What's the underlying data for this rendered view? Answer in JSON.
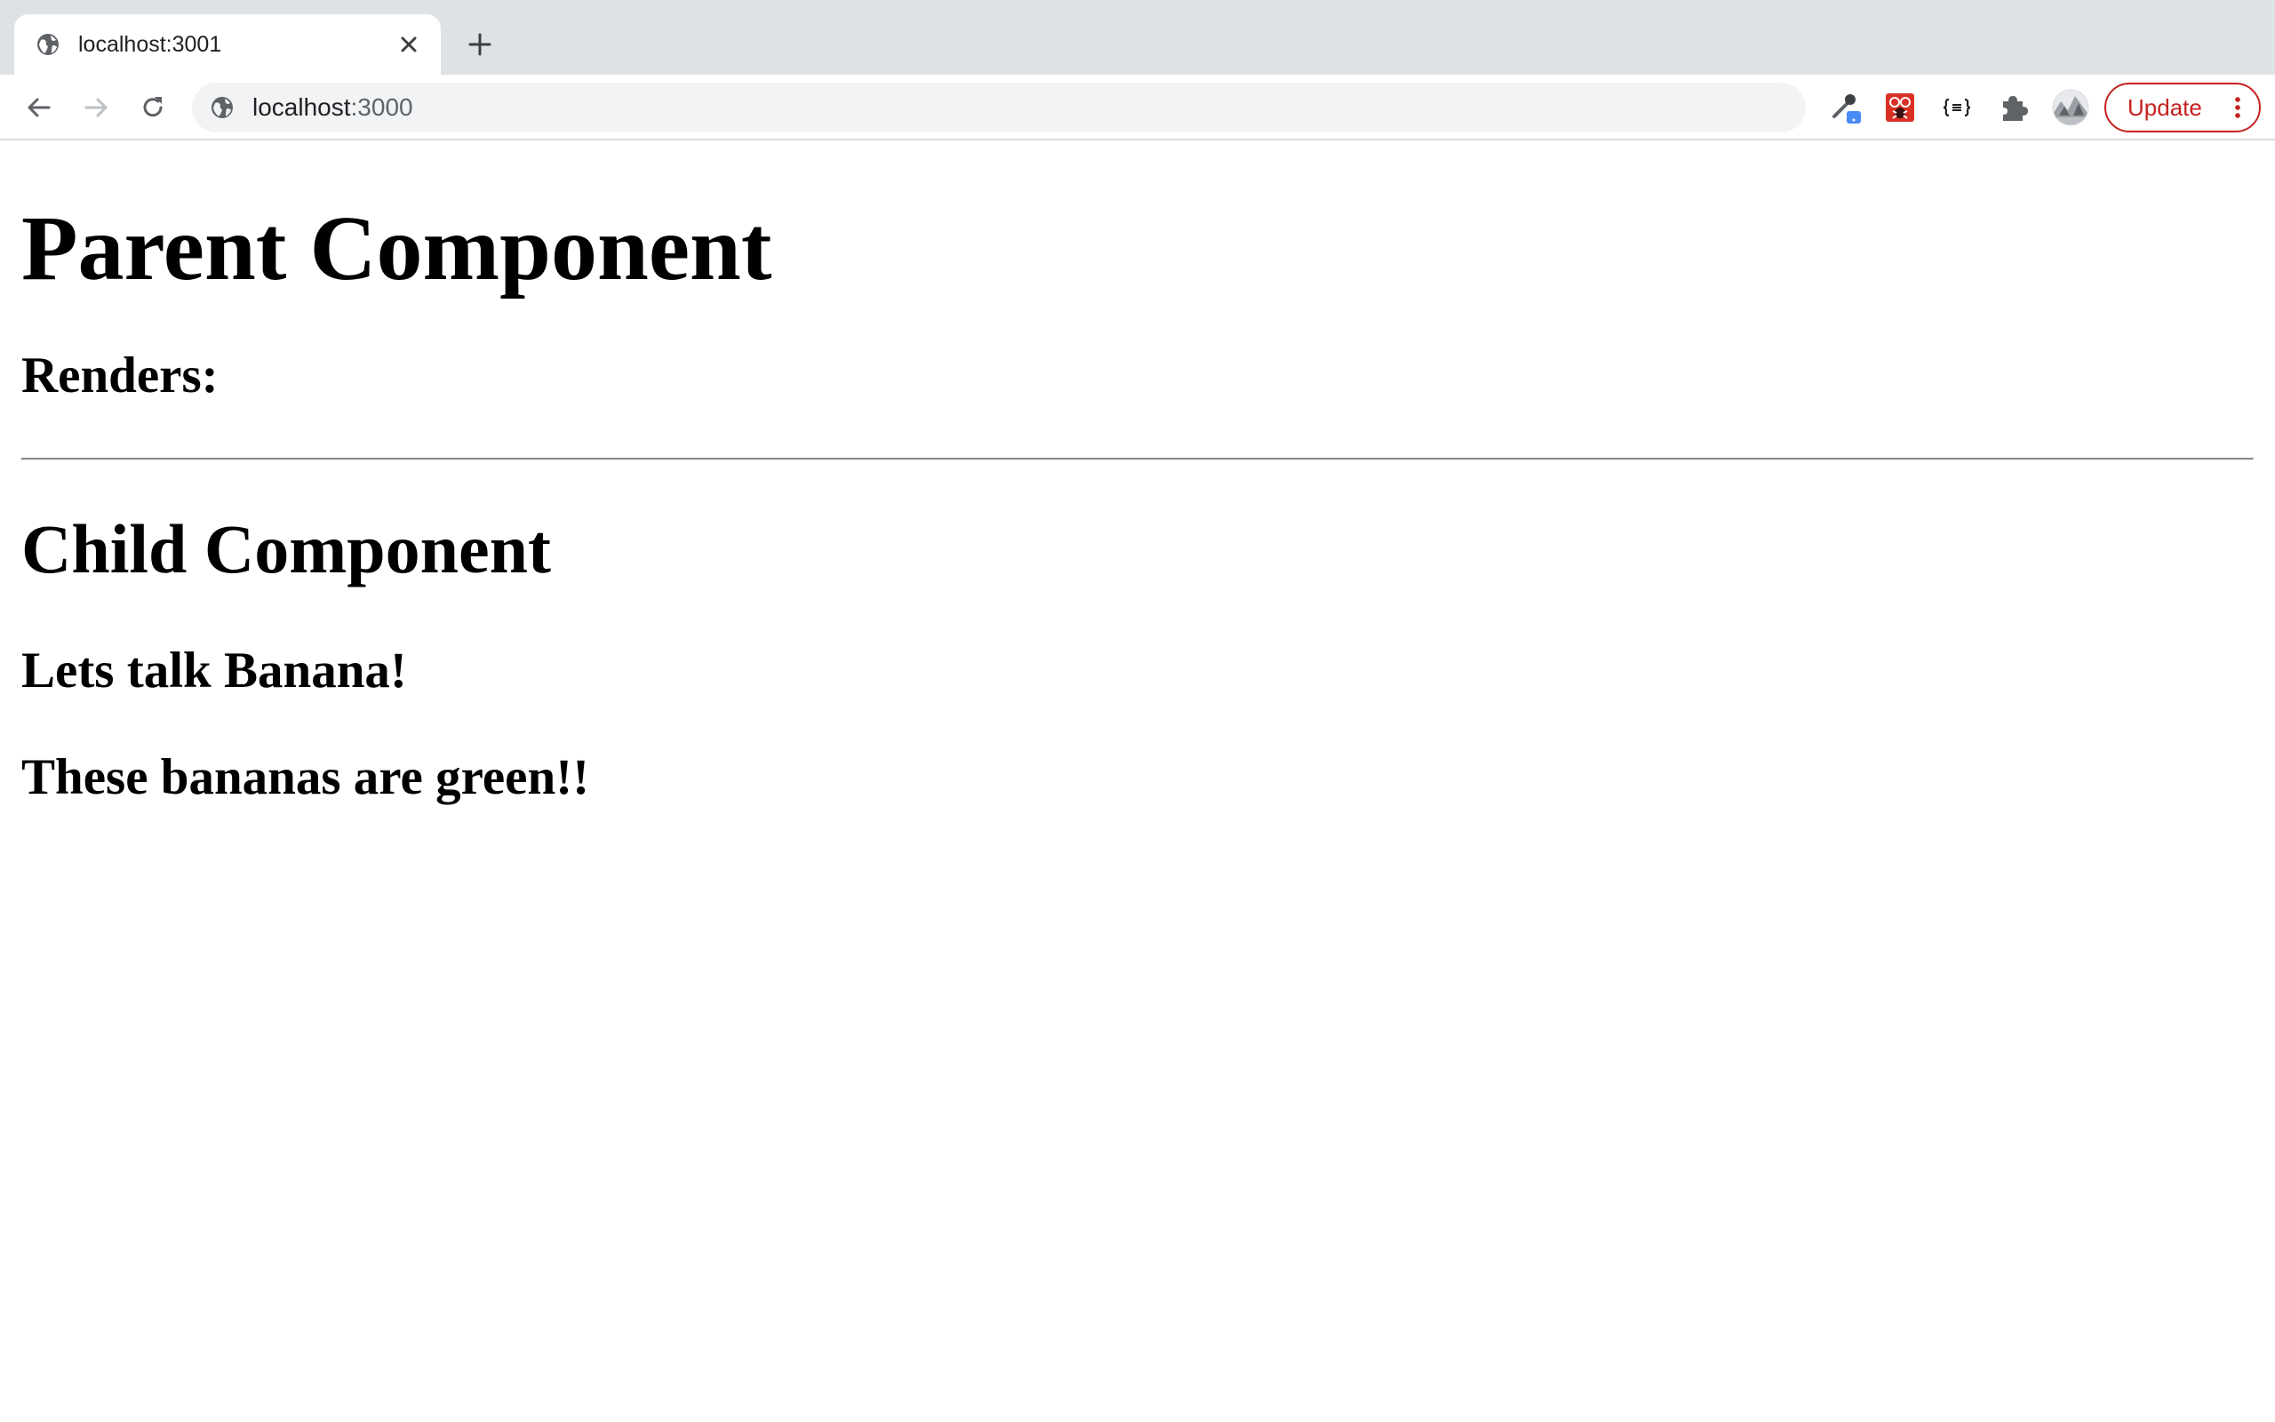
{
  "browser": {
    "tab": {
      "title": "localhost:3001",
      "favicon": "globe-icon",
      "close": "close-icon"
    },
    "new_tab": "plus-icon",
    "nav": {
      "back": "arrow-left-icon",
      "forward": "arrow-right-icon",
      "reload": "reload-icon"
    },
    "address": {
      "host": "localhost",
      "port": ":3000",
      "site_icon": "globe-icon"
    },
    "extensions": [
      "eyedropper-icon",
      "bug-extension-icon",
      "json-formatter-icon",
      "puzzle-icon",
      "profile-avatar-icon"
    ],
    "update_button": {
      "label": "Update",
      "menu": "vertical-dots-icon"
    },
    "colors": {
      "tabstrip": "#dee1e6",
      "omnibox": "#f1f3f4",
      "update_accent": "#c5221f",
      "icon": "#5f6368"
    }
  },
  "page": {
    "parent_heading": "Parent Component",
    "renders_label": "Renders:",
    "child_heading": "Child Component",
    "talk_heading": "Lets talk Banana!",
    "green_heading": "These bananas are green!!"
  }
}
